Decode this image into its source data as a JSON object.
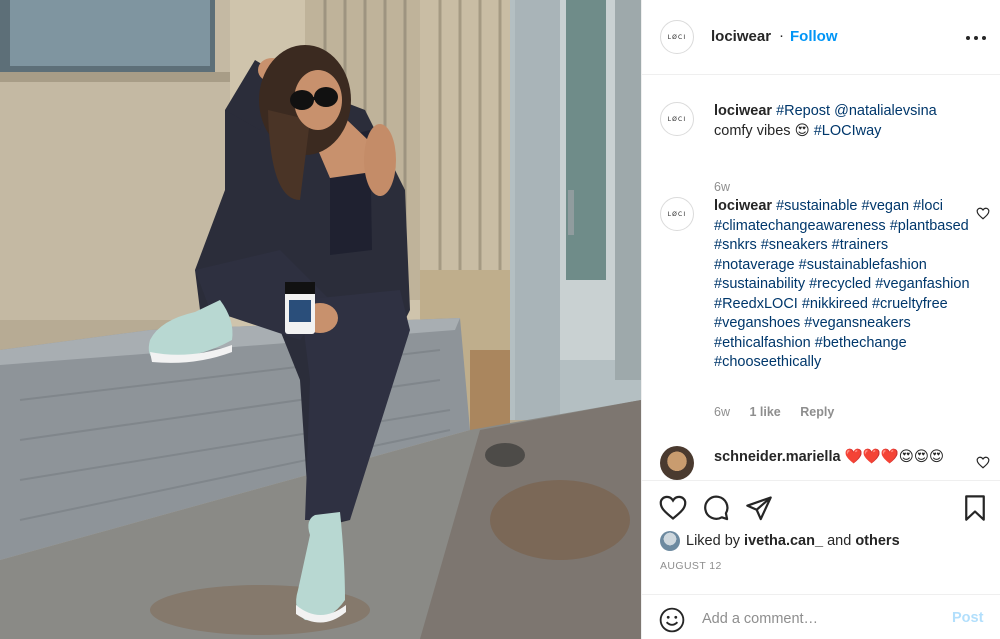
{
  "post": {
    "image_alt_icon": "photo-woman-sitting-on-step",
    "author": "lociwear",
    "avatar_text": "LØCI",
    "follow_label": "Follow",
    "dot": "·",
    "more_icon": "more-horizontal-icon"
  },
  "comments": [
    {
      "username": "lociwear",
      "parts": [
        "#Repost",
        " ",
        "@natalialevsina",
        " comfy vibes 😍 ",
        "#LOCIway"
      ],
      "time": "6w"
    },
    {
      "username": "lociwear",
      "text": "#sustainable #vegan #loci #climatechangeawareness #plantbased #snkrs #sneakers #trainers #notaverage #sustainablefashion #sustainability #recycled #veganfashion #ReedxLOCI #nikkireed #crueltyfree #veganshoes #vegansneakers #ethicalfashion #bethechange #chooseethically",
      "time": "6w",
      "likes": "1 like",
      "reply": "Reply"
    },
    {
      "username": "schneider.mariella",
      "text": "❤️❤️❤️😍😍😍"
    }
  ],
  "actions": {
    "liked_by_prefix": "Liked by ",
    "liked_by_user": "ivetha.can_",
    "liked_by_mid": " and ",
    "liked_by_others": "others",
    "date": "AUGUST 12",
    "comment_placeholder": "Add a comment…",
    "post_label": "Post"
  },
  "colors": {
    "link": "#00376b",
    "follow": "#0095f6",
    "post_disabled": "#b2dffc",
    "muted": "#8e8e8e"
  }
}
